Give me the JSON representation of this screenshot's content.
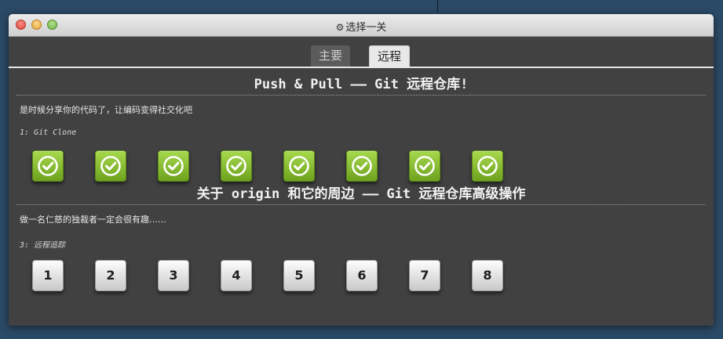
{
  "window": {
    "title": "选择一关",
    "title_icon": "gear-icon"
  },
  "tabs": [
    {
      "label": "主要",
      "active": false
    },
    {
      "label": "远程",
      "active": true
    }
  ],
  "sections": [
    {
      "title": "Push & Pull —— Git 远程仓库!",
      "description": "是时候分享你的代码了，让编码变得社交化吧",
      "subtitle": "1: Git Clone",
      "levels": [
        {
          "state": "completed",
          "icon": "checkmark-icon"
        },
        {
          "state": "completed",
          "icon": "checkmark-icon"
        },
        {
          "state": "completed",
          "icon": "checkmark-icon"
        },
        {
          "state": "completed",
          "icon": "checkmark-icon"
        },
        {
          "state": "completed",
          "icon": "checkmark-icon"
        },
        {
          "state": "completed",
          "icon": "checkmark-icon"
        },
        {
          "state": "completed",
          "icon": "checkmark-icon"
        },
        {
          "state": "completed",
          "icon": "checkmark-icon"
        }
      ]
    },
    {
      "title": "关于 origin 和它的周边 —— Git 远程仓库高级操作",
      "description": "做一名仁慈的独裁者一定会很有趣……",
      "subtitle": "3: 远程追踪",
      "levels": [
        {
          "state": "available",
          "label": "1"
        },
        {
          "state": "available",
          "label": "2"
        },
        {
          "state": "available",
          "label": "3"
        },
        {
          "state": "available",
          "label": "4"
        },
        {
          "state": "available",
          "label": "5"
        },
        {
          "state": "available",
          "label": "6"
        },
        {
          "state": "available",
          "label": "7"
        },
        {
          "state": "available",
          "label": "8"
        }
      ]
    }
  ],
  "colors": {
    "desktop": "#2b4a67",
    "window_bg": "#414141",
    "completed_green": "#8cc63f",
    "level_button": "#e8e8e8"
  }
}
